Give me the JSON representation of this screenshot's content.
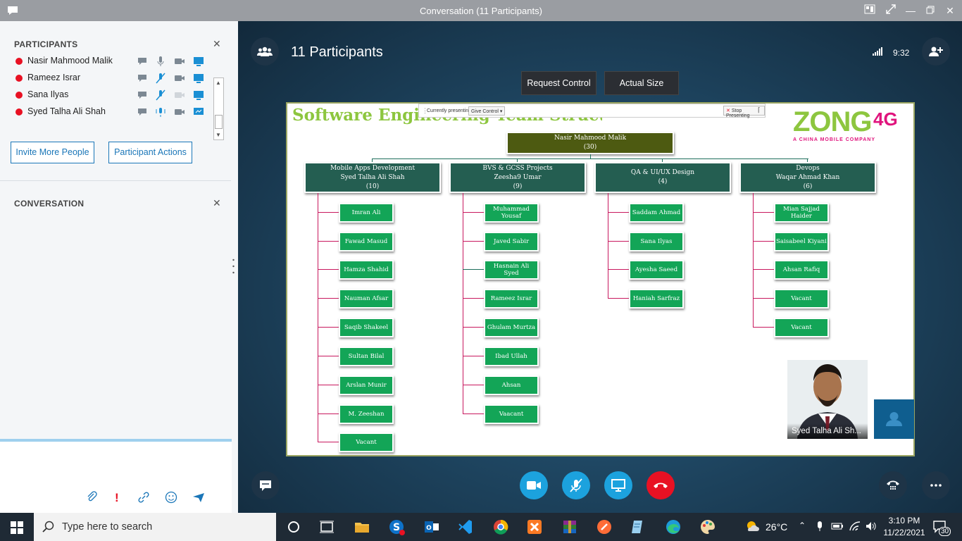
{
  "window": {
    "title": "Conversation (11 Participants)"
  },
  "sidebar": {
    "participants_heading": "PARTICIPANTS",
    "participants": [
      {
        "name": "Nasir Mahmood Malik",
        "mic": "on",
        "video": "off",
        "sharing": true
      },
      {
        "name": "Rameez Israr",
        "mic": "muted",
        "video": "off",
        "sharing": true
      },
      {
        "name": "Sana Ilyas",
        "mic": "muted",
        "video": "off",
        "sharing": true
      },
      {
        "name": "Syed Talha Ali Shah",
        "mic": "active",
        "video": "off",
        "sharing": "presenting"
      }
    ],
    "invite_label": "Invite More People",
    "actions_label": "Participant Actions",
    "conversation_heading": "CONVERSATION"
  },
  "call": {
    "participants_label": "11 Participants",
    "time": "9:32",
    "request_control_label": "Request Control",
    "actual_size_label": "Actual Size",
    "self_view_name": "Syed Talha Ali Sh..."
  },
  "presenting_bar": {
    "currently_presenting": "Currently presenting",
    "give_control": "Give Control",
    "stop_presenting": "Stop Presenting"
  },
  "slide": {
    "title": "Software Engineering Team Structure",
    "logo": {
      "word": "ZONG",
      "suffix": "4G",
      "tagline": "A CHINA MOBILE COMPANY"
    },
    "root": {
      "name": "Nasir Mahmood Malik",
      "count": "(30)"
    },
    "teams": [
      {
        "title": "Mobile Apps Development",
        "lead": "Syed Talha Ali Shah",
        "count": "(10)",
        "members": [
          "Imran Ali",
          "Fawad Masud",
          "Hamza Shahid",
          "Nauman Afsar",
          "Saqib Shakeel",
          "Sultan Bilal",
          "Arslan Munir",
          "M. Zeeshan",
          "Vacant"
        ]
      },
      {
        "title": "BVS & GCSS Projects",
        "lead": "Zeesha9 Umar",
        "count": "(9)",
        "members": [
          "Muhammad Yousaf",
          "Javed Sabir",
          "Hasnain Ali Syed",
          "Rameez Israr",
          "Ghulam Murtza",
          "Ibad Ullah",
          "Ahsan",
          "Vaacant"
        ]
      },
      {
        "title": "QA & UI/UX Design",
        "lead": "",
        "count": "(4)",
        "members": [
          "Saddam Ahmad",
          "Sana Ilyas",
          "Ayesha Saeed",
          "Haniah Sarfraz"
        ]
      },
      {
        "title": "Devops",
        "lead": "Waqar Ahmad Khan",
        "count": "(6)",
        "members": [
          "Mian Sajjad Haider",
          "Saisabeel Kiyani",
          "Ahsan Rafiq",
          "Vacant",
          "Vacant"
        ]
      }
    ]
  },
  "taskbar": {
    "search_placeholder": "Type here to search",
    "weather": "26°C",
    "clock_time": "3:10 PM",
    "clock_date": "11/22/2021",
    "notifications": "30"
  },
  "colors": {
    "accent": "#1a76b8",
    "presence_busy": "#e81123",
    "end_call": "#e81123",
    "call_button": "#1ca2de"
  }
}
